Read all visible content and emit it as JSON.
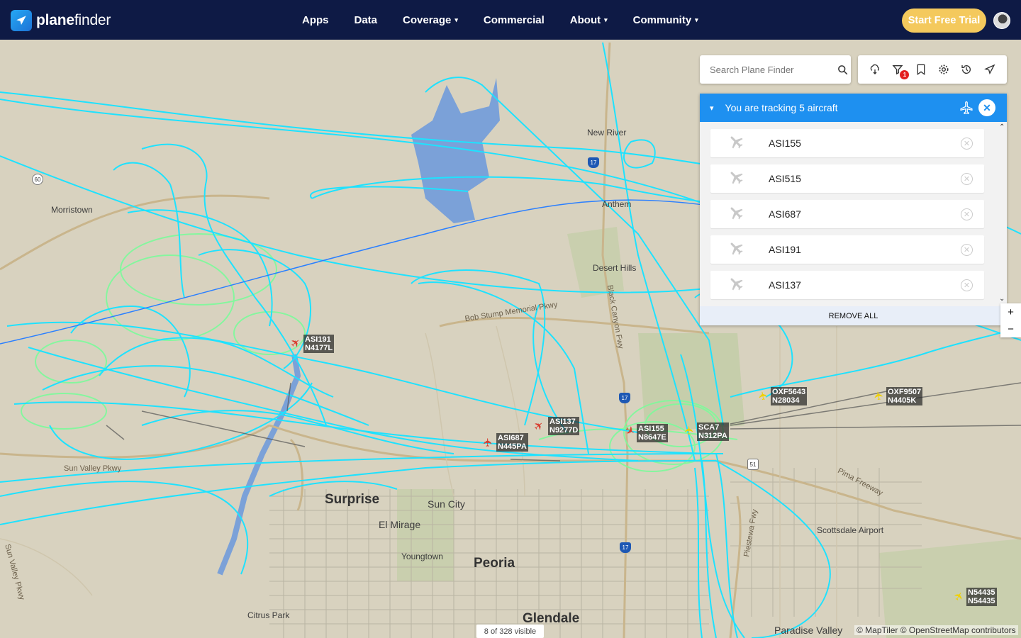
{
  "brand": {
    "name_bold": "plane",
    "name_rest": "finder"
  },
  "nav": [
    {
      "label": "Apps",
      "dropdown": false
    },
    {
      "label": "Data",
      "dropdown": false
    },
    {
      "label": "Coverage",
      "dropdown": true
    },
    {
      "label": "Commercial",
      "dropdown": false
    },
    {
      "label": "About",
      "dropdown": true
    },
    {
      "label": "Community",
      "dropdown": true
    }
  ],
  "cta": {
    "label": "Start Free Trial"
  },
  "search": {
    "placeholder": "Search Plane Finder"
  },
  "toolbar": {
    "icons": [
      "weather-icon",
      "filter-icon",
      "bookmark-icon",
      "settings-icon",
      "history-icon",
      "aircraft-settings-icon"
    ],
    "filter_badge": "1"
  },
  "tracking": {
    "title": "You are tracking 5 aircraft",
    "aircraft": [
      "ASI155",
      "ASI515",
      "ASI687",
      "ASI191",
      "ASI137"
    ],
    "remove_all": "REMOVE ALL"
  },
  "zoom": {
    "in": "+",
    "out": "−"
  },
  "map_labels": {
    "places": [
      {
        "name": "New River",
        "big": false
      },
      {
        "name": "Morristown",
        "big": false
      },
      {
        "name": "Anthem",
        "big": false
      },
      {
        "name": "Desert Hills",
        "big": false
      },
      {
        "name": "Surprise",
        "big": true
      },
      {
        "name": "Sun City",
        "big": false
      },
      {
        "name": "El Mirage",
        "big": false
      },
      {
        "name": "Youngtown",
        "big": false
      },
      {
        "name": "Peoria",
        "big": true
      },
      {
        "name": "Citrus Park",
        "big": false
      },
      {
        "name": "Glendale",
        "big": true
      },
      {
        "name": "Scottsdale Airport",
        "big": false
      },
      {
        "name": "Paradise Valley",
        "big": false
      }
    ],
    "roads": [
      "Bob Stump Memorial Pkwy",
      "Sun Valley Pkwy",
      "Pima Freeway",
      "Black Canyon Fwy",
      "Piestewa Fwy",
      "Sun Valley Pkwy"
    ],
    "shields": [
      "60",
      "17",
      "17",
      "17",
      "51"
    ]
  },
  "aircraft_labels": [
    {
      "callsign": "ASI191",
      "reg": "N4177L",
      "color": "red"
    },
    {
      "callsign": "ASI137",
      "reg": "N9277D",
      "color": "red"
    },
    {
      "callsign": "ASI687",
      "reg": "N445PA",
      "color": "red"
    },
    {
      "callsign": "ASI155",
      "reg": "N8647E",
      "color": "red"
    },
    {
      "callsign": "SCA7",
      "reg": "N312PA",
      "color": "yellow"
    },
    {
      "callsign": "OXF5643",
      "reg": "N28034",
      "color": "yellow"
    },
    {
      "callsign": "OXF9507",
      "reg": "N4405K",
      "color": "yellow"
    },
    {
      "callsign": "N54435",
      "reg": "N54435",
      "color": "yellow"
    }
  ],
  "status": {
    "visible": "8 of 328 visible"
  },
  "attribution": "© MapTiler © OpenStreetMap contributors",
  "colors": {
    "header": "#0e1a45",
    "cta": "#f4c95d",
    "track_path": "#1ee2ff",
    "track_low": "#7dfb9b",
    "panel_head": "#1e90f0"
  }
}
